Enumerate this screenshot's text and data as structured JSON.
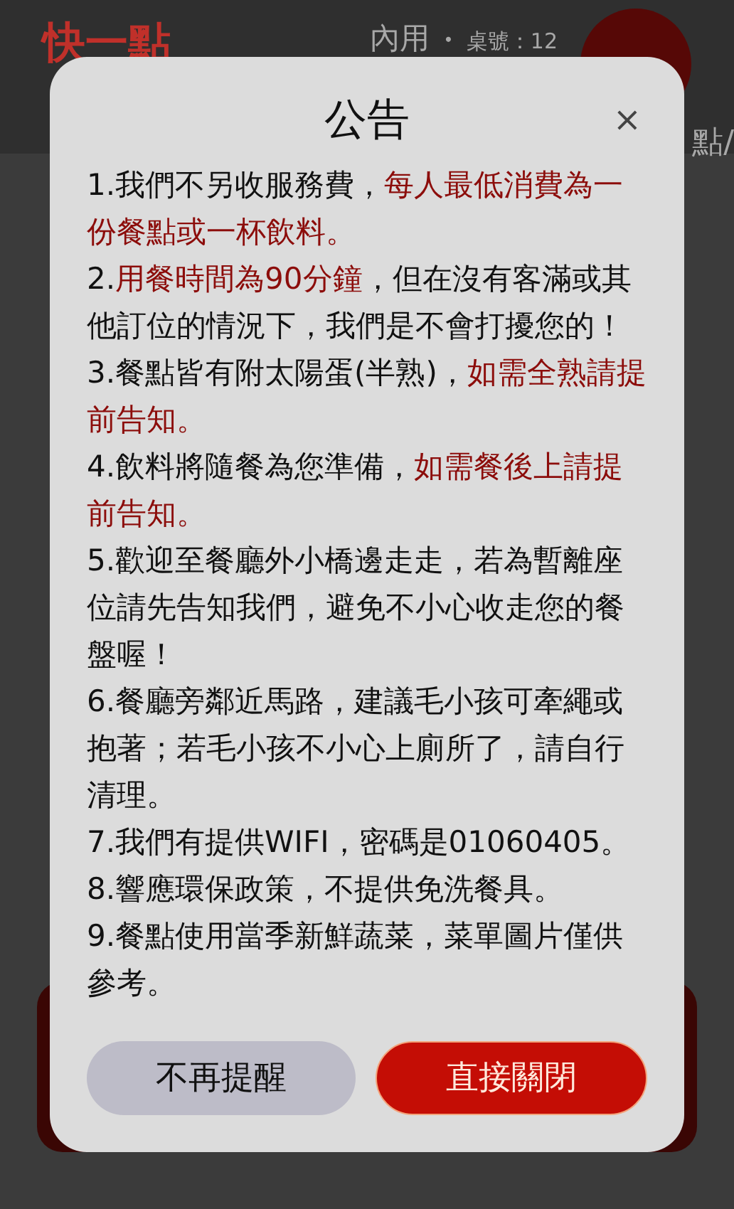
{
  "header": {
    "logo": "快一點",
    "dining_mode": "內用",
    "separator": "・",
    "table": "桌號：12",
    "category_fragment": "點/"
  },
  "dialog": {
    "title": "公告",
    "close": "×",
    "items": [
      {
        "segments": [
          {
            "text": "1.我們不另收服務費，",
            "highlight": false
          },
          {
            "text": "每人最低消費為一份餐點或一杯飲料。",
            "highlight": true
          }
        ]
      },
      {
        "segments": [
          {
            "text": "2.",
            "highlight": false
          },
          {
            "text": "用餐時間為90分鐘",
            "highlight": true
          },
          {
            "text": "，但在沒有客滿或其他訂位的情況下，我們是不會打擾您的！",
            "highlight": false
          }
        ]
      },
      {
        "segments": [
          {
            "text": "3.餐點皆有附太陽蛋(半熟)，",
            "highlight": false
          },
          {
            "text": "如需全熟請提前告知。",
            "highlight": true
          }
        ]
      },
      {
        "segments": [
          {
            "text": "4.飲料將隨餐為您準備，",
            "highlight": false
          },
          {
            "text": "如需餐後上請提前告知。",
            "highlight": true
          }
        ]
      },
      {
        "segments": [
          {
            "text": "5.歡迎至餐廳外小橋邊走走，若為暫離座位請先告知我們，避免不小心收走您的餐盤喔！",
            "highlight": false
          }
        ]
      },
      {
        "segments": [
          {
            "text": "6.餐廳旁鄰近馬路，建議毛小孩可牽繩或抱著；若毛小孩不小心上廁所了，請自行清理。",
            "highlight": false
          }
        ]
      },
      {
        "segments": [
          {
            "text": "7.我們有提供WIFI，密碼是01060405。",
            "highlight": false
          }
        ]
      },
      {
        "segments": [
          {
            "text": "8.響應環保政策，不提供免洗餐具。",
            "highlight": false
          }
        ]
      },
      {
        "segments": [
          {
            "text": "9.餐點使用當季新鮮蔬菜，菜單圖片僅供參考。",
            "highlight": false
          }
        ]
      }
    ],
    "buttons": [
      {
        "label": "不再提醒",
        "kind": "secondary"
      },
      {
        "label": "直接關閉",
        "kind": "primary"
      }
    ]
  }
}
